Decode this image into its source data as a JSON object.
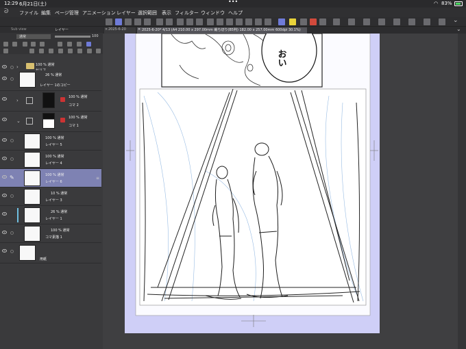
{
  "status_bar": {
    "time": "12:29",
    "date": "6月21日(土)",
    "dots": "•••",
    "wifi_icon": "wifi-icon",
    "battery": "83%"
  },
  "menu": {
    "items": [
      "ファイル",
      "編集",
      "ページ管理",
      "アニメーション",
      "レイヤー",
      "選択範囲",
      "表示",
      "フィルター",
      "ウィンドウ",
      "ヘルプ"
    ]
  },
  "tabs": [
    {
      "label": "2025-6-20"
    },
    {
      "label": "2025-6-20* 4/13 (A4 210.00 x 297.00mm 裁ち切り(B5判) 182.00 x 257.00mm 600dpi 30.1%)"
    }
  ],
  "panel": {
    "sub_label": "Sub view",
    "title": "レイヤー",
    "blend_mode": "通常",
    "opacity": "100"
  },
  "layers": [
    {
      "mode": "100 % 通常",
      "name": "セリフ",
      "kind": "folder"
    },
    {
      "mode": "26 % 通常",
      "name": "レイヤー 1のコピー",
      "kind": "raster"
    },
    {
      "mode": "100 % 通常",
      "name": "コマ 2",
      "kind": "frame"
    },
    {
      "mode": "100 % 通常",
      "name": "コマ 1",
      "kind": "frame"
    },
    {
      "mode": "100 % 通常",
      "name": "レイヤー 5",
      "kind": "raster"
    },
    {
      "mode": "100 % 通常",
      "name": "レイヤー 4",
      "kind": "raster"
    },
    {
      "mode": "100 % 通常",
      "name": "レイヤー 6",
      "kind": "raster",
      "selected": true
    },
    {
      "mode": "10 % 通常",
      "name": "レイヤー 3",
      "kind": "raster"
    },
    {
      "mode": "26 % 通常",
      "name": "レイヤー 1",
      "kind": "raster"
    },
    {
      "mode": "100 % 通常",
      "name": "コマ素描 1",
      "kind": "raster"
    },
    {
      "mode": "",
      "name": "用紙",
      "kind": "paper"
    }
  ],
  "canvas": {
    "speech": "おい",
    "paper_color": "#cfcff7",
    "accent": "#6f7bd8"
  }
}
